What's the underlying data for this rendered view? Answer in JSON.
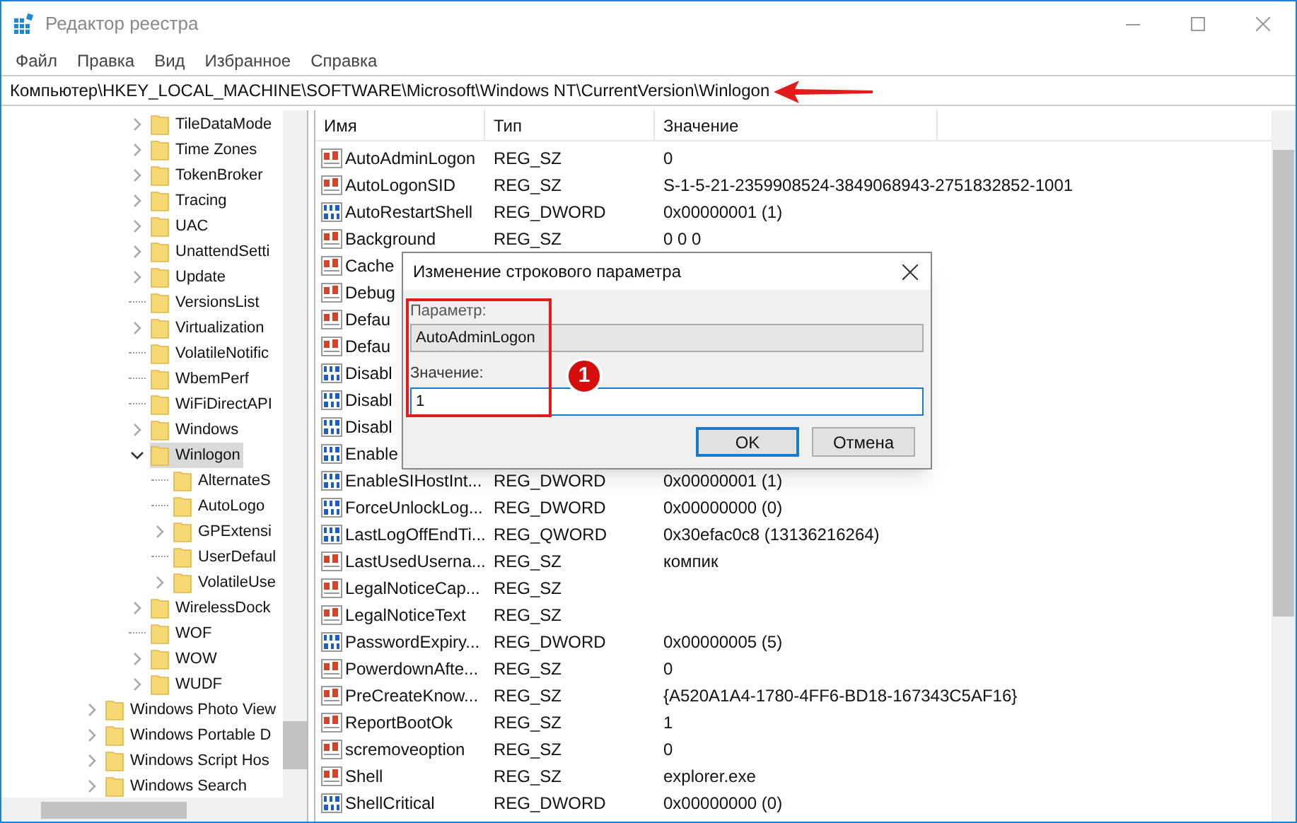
{
  "window": {
    "title": "Редактор реестра"
  },
  "menu": [
    "Файл",
    "Правка",
    "Вид",
    "Избранное",
    "Справка"
  ],
  "address": "Компьютер\\HKEY_LOCAL_MACHINE\\SOFTWARE\\Microsoft\\Windows NT\\CurrentVersion\\Winlogon",
  "tree": {
    "inner_items": [
      {
        "label": "TileDataMode",
        "kind": "branch",
        "expanded": false,
        "selected": false
      },
      {
        "label": "Time Zones",
        "kind": "branch",
        "expanded": false,
        "selected": false
      },
      {
        "label": "TokenBroker",
        "kind": "branch",
        "expanded": false,
        "selected": false
      },
      {
        "label": "Tracing",
        "kind": "branch",
        "expanded": false,
        "selected": false
      },
      {
        "label": "UAC",
        "kind": "branch",
        "expanded": false,
        "selected": false
      },
      {
        "label": "UnattendSetti",
        "kind": "branch",
        "expanded": false,
        "selected": false
      },
      {
        "label": "Update",
        "kind": "branch",
        "expanded": false,
        "selected": false
      },
      {
        "label": "VersionsList",
        "kind": "leaf",
        "selected": false
      },
      {
        "label": "Virtualization",
        "kind": "branch",
        "expanded": false,
        "selected": false
      },
      {
        "label": "VolatileNotific",
        "kind": "leaf",
        "selected": false
      },
      {
        "label": "WbemPerf",
        "kind": "leaf",
        "selected": false
      },
      {
        "label": "WiFiDirectAPI",
        "kind": "leaf",
        "selected": false
      },
      {
        "label": "Windows",
        "kind": "branch",
        "expanded": false,
        "selected": false
      },
      {
        "label": "Winlogon",
        "kind": "branch",
        "expanded": true,
        "selected": true,
        "children": [
          {
            "label": "AlternateS",
            "kind": "leaf",
            "selected": false
          },
          {
            "label": "AutoLogo",
            "kind": "leaf",
            "selected": false
          },
          {
            "label": "GPExtensi",
            "kind": "branch",
            "expanded": false,
            "selected": false
          },
          {
            "label": "UserDefaul",
            "kind": "leaf",
            "selected": false
          },
          {
            "label": "VolatileUse",
            "kind": "branch",
            "expanded": false,
            "selected": false
          }
        ]
      },
      {
        "label": "WirelessDock",
        "kind": "branch",
        "expanded": false,
        "selected": false
      },
      {
        "label": "WOF",
        "kind": "leaf",
        "selected": false
      },
      {
        "label": "WOW",
        "kind": "branch",
        "expanded": false,
        "selected": false
      },
      {
        "label": "WUDF",
        "kind": "branch",
        "expanded": false,
        "selected": false
      }
    ],
    "outer_items": [
      {
        "label": "Windows Photo View",
        "kind": "branch",
        "expanded": false,
        "selected": false
      },
      {
        "label": "Windows Portable D",
        "kind": "branch",
        "expanded": false,
        "selected": false
      },
      {
        "label": "Windows Script Hos",
        "kind": "branch",
        "expanded": false,
        "selected": false
      },
      {
        "label": "Windows Search",
        "kind": "branch",
        "expanded": false,
        "selected": false
      }
    ]
  },
  "table": {
    "columns": [
      "Имя",
      "Тип",
      "Значение"
    ],
    "rows": [
      {
        "kind": "string",
        "name": "AutoAdminLogon",
        "type": "REG_SZ",
        "value": "0"
      },
      {
        "kind": "string",
        "name": "AutoLogonSID",
        "type": "REG_SZ",
        "value": "S-1-5-21-2359908524-3849068943-2751832852-1001"
      },
      {
        "kind": "binary",
        "name": "AutoRestartShell",
        "type": "REG_DWORD",
        "value": "0x00000001 (1)"
      },
      {
        "kind": "string",
        "name": "Background",
        "type": "REG_SZ",
        "value": "0 0 0"
      },
      {
        "kind": "string",
        "name": "Cache"
      },
      {
        "kind": "string",
        "name": "Debug"
      },
      {
        "kind": "string",
        "name": "Defau"
      },
      {
        "kind": "string",
        "name": "Defau"
      },
      {
        "kind": "binary",
        "name": "Disabl"
      },
      {
        "kind": "binary",
        "name": "Disabl"
      },
      {
        "kind": "binary",
        "name": "Disabl"
      },
      {
        "kind": "binary",
        "name": "Enable"
      },
      {
        "kind": "binary",
        "name": "EnableSIHostInt...",
        "type": "REG_DWORD",
        "value": "0x00000001 (1)"
      },
      {
        "kind": "binary",
        "name": "ForceUnlockLog...",
        "type": "REG_DWORD",
        "value": "0x00000000 (0)"
      },
      {
        "kind": "binary",
        "name": "LastLogOffEndTi...",
        "type": "REG_QWORD",
        "value": "0x30efac0c8 (13136216264)"
      },
      {
        "kind": "string",
        "name": "LastUsedUserna...",
        "type": "REG_SZ",
        "value": "компик"
      },
      {
        "kind": "string",
        "name": "LegalNoticeCap...",
        "type": "REG_SZ"
      },
      {
        "kind": "string",
        "name": "LegalNoticeText",
        "type": "REG_SZ"
      },
      {
        "kind": "binary",
        "name": "PasswordExpiry...",
        "type": "REG_DWORD",
        "value": "0x00000005 (5)"
      },
      {
        "kind": "string",
        "name": "PowerdownAfte...",
        "type": "REG_SZ",
        "value": "0"
      },
      {
        "kind": "string",
        "name": "PreCreateKnow...",
        "type": "REG_SZ",
        "value": "{A520A1A4-1780-4FF6-BD18-167343C5AF16}"
      },
      {
        "kind": "string",
        "name": "ReportBootOk",
        "type": "REG_SZ",
        "value": "1"
      },
      {
        "kind": "string",
        "name": "scremoveoption",
        "type": "REG_SZ",
        "value": "0"
      },
      {
        "kind": "string",
        "name": "Shell",
        "type": "REG_SZ",
        "value": "explorer.exe"
      },
      {
        "kind": "binary",
        "name": "ShellCritical",
        "type": "REG_DWORD",
        "value": "0x00000000 (0)"
      }
    ]
  },
  "dialog": {
    "title": "Изменение строкового параметра",
    "name_label": "Параметр:",
    "name_value": "AutoAdminLogon",
    "value_label": "Значение:",
    "value": "1",
    "buttons": [
      "OK",
      "Отмена"
    ]
  },
  "annotation": {
    "step": "1"
  }
}
